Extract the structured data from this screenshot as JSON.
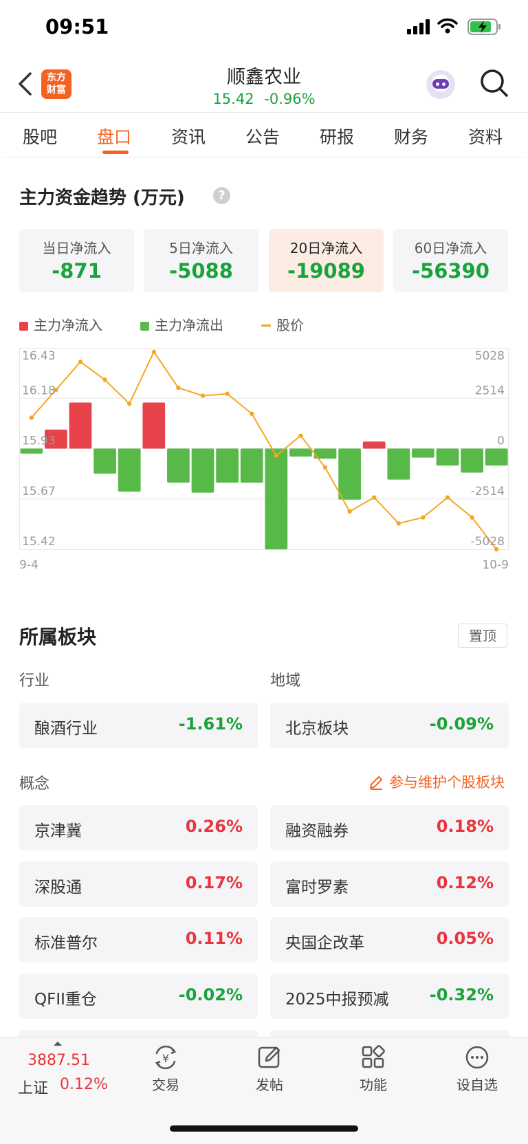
{
  "status_bar": {
    "time": "09:51"
  },
  "header": {
    "logo_text": [
      "东方",
      "财富"
    ],
    "stock_name": "顺鑫农业",
    "price": "15.42",
    "change_pct": "-0.96%"
  },
  "tabs": [
    {
      "label": "股吧"
    },
    {
      "label": "盘口",
      "active": true
    },
    {
      "label": "资讯"
    },
    {
      "label": "公告"
    },
    {
      "label": "研报"
    },
    {
      "label": "财务"
    },
    {
      "label": "资料"
    }
  ],
  "money_flow": {
    "title": "主力资金趋势 (万元)",
    "help": "?",
    "cards": [
      {
        "label": "当日净流入",
        "value": "-871"
      },
      {
        "label": "5日净流入",
        "value": "-5088"
      },
      {
        "label": "20日净流入",
        "value": "-19089",
        "active": true
      },
      {
        "label": "60日净流入",
        "value": "-56390"
      }
    ],
    "legend": {
      "inflow": "主力净流入",
      "outflow": "主力净流出",
      "price": "股价"
    },
    "colors": {
      "inflow": "#e8424a",
      "outflow": "#57b947",
      "price": "#f5a623"
    }
  },
  "chart_data": {
    "type": "bar",
    "x_start_label": "9-4",
    "x_end_label": "10-9",
    "left_axis_ticks": [
      "16.43",
      "16.18",
      "15.93",
      "15.67",
      "15.42"
    ],
    "right_axis_ticks": [
      "5028",
      "2514",
      "0",
      "-2514",
      "-5028"
    ],
    "left_ylim": [
      15.42,
      16.43
    ],
    "right_ylim": [
      -5028,
      5028
    ],
    "series": [
      {
        "name": "主力净流入/净流出",
        "values": [
          -250,
          950,
          2300,
          -1250,
          -2150,
          2300,
          -1700,
          -2200,
          -1700,
          -1700,
          -5028,
          -400,
          -500,
          -2550,
          350,
          -1550,
          -450,
          -850,
          -1200,
          -850
        ]
      },
      {
        "name": "股价",
        "values": [
          16.08,
          16.22,
          16.36,
          16.27,
          16.15,
          16.41,
          16.23,
          16.19,
          16.2,
          16.1,
          15.89,
          15.99,
          15.83,
          15.61,
          15.68,
          15.55,
          15.58,
          15.68,
          15.58,
          15.42
        ]
      }
    ]
  },
  "sectors": {
    "title": "所属板块",
    "pin_label": "置顶",
    "industry_label": "行业",
    "region_label": "地域",
    "industry": {
      "name": "酿酒行业",
      "change": "-1.61%"
    },
    "region": {
      "name": "北京板块",
      "change": "-0.09%"
    },
    "concept_label": "概念",
    "maintain_link": "参与维护个股板块",
    "concepts": [
      {
        "name": "京津冀",
        "change": "0.26%"
      },
      {
        "name": "融资融券",
        "change": "0.18%"
      },
      {
        "name": "深股通",
        "change": "0.17%"
      },
      {
        "name": "富时罗素",
        "change": "0.12%"
      },
      {
        "name": "标准普尔",
        "change": "0.11%"
      },
      {
        "name": "央国企改革",
        "change": "0.05%"
      },
      {
        "name": "QFII重仓",
        "change": "-0.02%"
      },
      {
        "name": "2025中报预减",
        "change": "-0.32%"
      }
    ]
  },
  "bottom_bar": {
    "index_value": "3887.51",
    "index_name": "上证",
    "index_change": "0.12%",
    "nav": [
      {
        "label": "交易",
        "icon": "trade-icon"
      },
      {
        "label": "发帖",
        "icon": "post-icon"
      },
      {
        "label": "功能",
        "icon": "grid-icon"
      },
      {
        "label": "设自选",
        "icon": "more-icon"
      }
    ]
  }
}
